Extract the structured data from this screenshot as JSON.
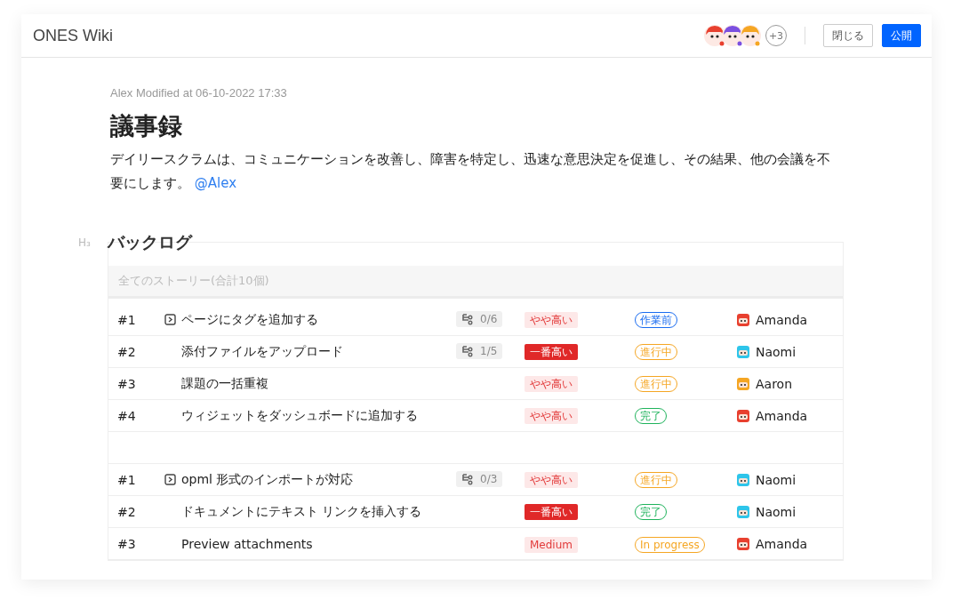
{
  "window": {
    "title": "ONES Wiki"
  },
  "header": {
    "avatars": [
      {
        "color": "#e8402f"
      },
      {
        "color": "#7b4fe0"
      },
      {
        "color": "#f5a623"
      }
    ],
    "more": "+3",
    "buttons": [
      {
        "label": "閉じる",
        "kind": "secondary"
      },
      {
        "label": "公開",
        "kind": "primary"
      }
    ]
  },
  "meta": "Alex Modified at 06-10-2022 17:33",
  "title": "議事録",
  "paragraph": "デイリースクラムは、コミュニケーションを改善し、障害を特定し、迅速な意思決定を促進し、その結果、他の会議を不要にします。",
  "mention": "@Alex",
  "section": {
    "marker": "H₃",
    "heading": "バックログ"
  },
  "table": {
    "header": "全てのストーリー(合計10個)",
    "groups": [
      {
        "rows": [
          {
            "id": "#1",
            "kind": "parent",
            "title": "ページにタグを追加する",
            "subtasks": "0/6",
            "priority": {
              "label": "やや高い",
              "kind": "high"
            },
            "status": {
              "label": "作業前",
              "color": "#1a6cf0"
            },
            "assignee": {
              "name": "Amanda",
              "color": "#e8402f"
            }
          },
          {
            "id": "#2",
            "kind": "child",
            "title": "添付ファイルをアップロード",
            "subtasks": "1/5",
            "priority": {
              "label": "一番高い",
              "kind": "highest"
            },
            "status": {
              "label": "進行中",
              "color": "#f5a623"
            },
            "assignee": {
              "name": "Naomi",
              "color": "#2ec5ea"
            }
          },
          {
            "id": "#3",
            "kind": "child",
            "title": "課題の一括重複",
            "priority": {
              "label": "やや高い",
              "kind": "high"
            },
            "status": {
              "label": "進行中",
              "color": "#f5a623"
            },
            "assignee": {
              "name": "Aaron",
              "color": "#f5a623"
            }
          },
          {
            "id": "#4",
            "kind": "child",
            "title": "ウィジェットをダッシュボードに追加する",
            "priority": {
              "label": "やや高い",
              "kind": "high"
            },
            "status": {
              "label": "完了",
              "color": "#1fb35c"
            },
            "assignee": {
              "name": "Amanda",
              "color": "#e8402f"
            }
          }
        ]
      },
      {
        "rows": [
          {
            "id": "#1",
            "kind": "parent",
            "title": "opml 形式のインポートが対応",
            "subtasks": "0/3",
            "priority": {
              "label": "やや高い",
              "kind": "high"
            },
            "status": {
              "label": "進行中",
              "color": "#f5a623"
            },
            "assignee": {
              "name": "Naomi",
              "color": "#2ec5ea"
            }
          },
          {
            "id": "#2",
            "kind": "child",
            "title": "ドキュメントにテキスト リンクを挿入する",
            "priority": {
              "label": "一番高い",
              "kind": "highest"
            },
            "status": {
              "label": "完了",
              "color": "#1fb35c"
            },
            "assignee": {
              "name": "Naomi",
              "color": "#2ec5ea"
            }
          },
          {
            "id": "#3",
            "kind": "child",
            "title": "Preview attachments",
            "priority": {
              "label": "Medium",
              "kind": "high"
            },
            "status": {
              "label": "In progress",
              "color": "#f5a623"
            },
            "assignee": {
              "name": "Amanda",
              "color": "#e8402f"
            }
          }
        ]
      }
    ]
  }
}
